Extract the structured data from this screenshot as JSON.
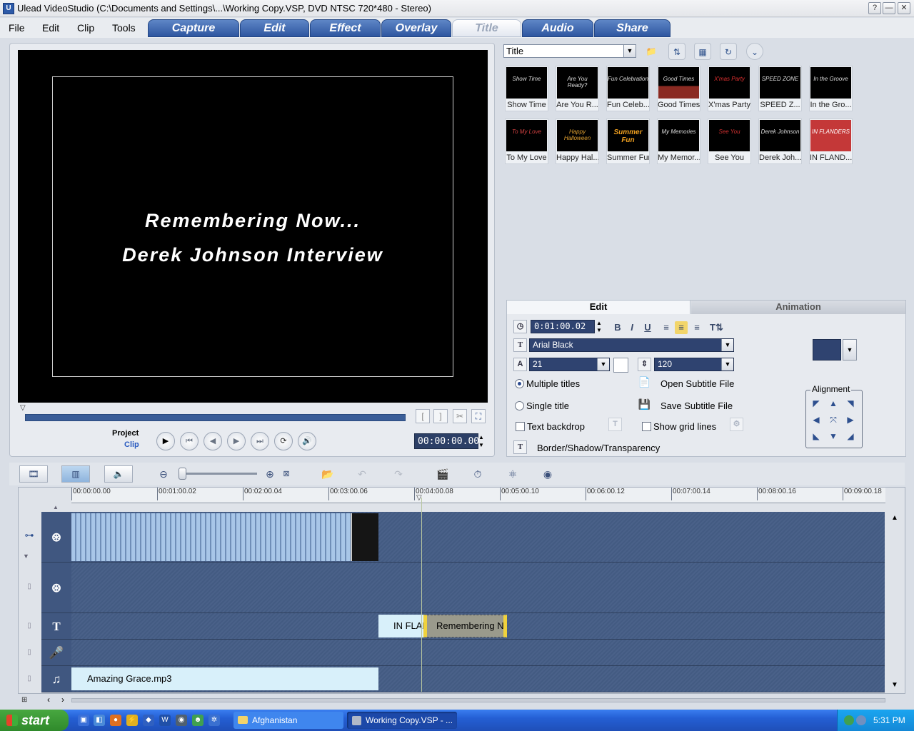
{
  "window": {
    "title": "Ulead VideoStudio (C:\\Documents and Settings\\...\\Working Copy.VSP, DVD NTSC 720*480 - Stereo)",
    "help_label": "?",
    "minimize_label": "—",
    "close_label": "✕"
  },
  "menu": [
    "File",
    "Edit",
    "Clip",
    "Tools"
  ],
  "mode_tabs": [
    "Capture",
    "Edit",
    "Effect",
    "Overlay",
    "Title",
    "Audio",
    "Share"
  ],
  "active_mode": "Title",
  "preview": {
    "line1": "Remembering Now...",
    "line2": "Derek Johnson Interview",
    "project_label": "Project",
    "clip_label": "Clip",
    "timecode": "00:00:00.00",
    "mark_in": "[",
    "mark_out": "]"
  },
  "library": {
    "category": "Title",
    "thumbnails": [
      {
        "caption": "Show Time",
        "art": "Show Time"
      },
      {
        "caption": "Are You R...",
        "art": "Are You Ready?"
      },
      {
        "caption": "Fun Celeb...",
        "art": "Fun Celebration"
      },
      {
        "caption": "Good Times",
        "art": "Good Times"
      },
      {
        "caption": "X'mas Party",
        "art": "X'mas Party"
      },
      {
        "caption": "SPEED Z...",
        "art": "SPEED ZONE"
      },
      {
        "caption": "In the Gro...",
        "art": "In the Groove"
      },
      {
        "caption": "To My Love",
        "art": "To My Love"
      },
      {
        "caption": "Happy Hal...",
        "art": "Happy Halloween"
      },
      {
        "caption": "Summer Fun",
        "art": "Summer Fun"
      },
      {
        "caption": "My Memor...",
        "art": "My Memories"
      },
      {
        "caption": "See You",
        "art": "See You"
      },
      {
        "caption": "Derek Joh...",
        "art": "Derek Johnson"
      },
      {
        "caption": "IN FLAND...",
        "art": "IN FLANDERS"
      }
    ]
  },
  "options": {
    "tab_edit": "Edit",
    "tab_animation": "Animation",
    "duration": "0:01:00.02",
    "bold": "B",
    "italic": "I",
    "underline": "U",
    "font": "Arial Black",
    "size": "21",
    "line_spacing": "120",
    "multiple_titles": "Multiple titles",
    "single_title": "Single title",
    "open_subtitle": "Open Subtitle File",
    "save_subtitle": "Save Subtitle File",
    "text_backdrop": "Text backdrop",
    "show_grid": "Show grid lines",
    "border_shadow": "Border/Shadow/Transparency",
    "alignment": "Alignment"
  },
  "ruler_ticks": [
    "00:00:00.00",
    "00:01:00.02",
    "00:02:00.04",
    "00:03:00.06",
    "00:04:00.08",
    "00:05:00.10",
    "00:06:00.12",
    "00:07:00.14",
    "00:08:00.16",
    "00:09:00.18"
  ],
  "clips": {
    "title1": "IN FLANDERS",
    "title2": "Remembering Now...",
    "audio": "Amazing Grace.mp3"
  },
  "taskbar": {
    "start": "start",
    "items": [
      "Afghanistan",
      "Working Copy.VSP - ..."
    ],
    "clock": "5:31 PM"
  }
}
